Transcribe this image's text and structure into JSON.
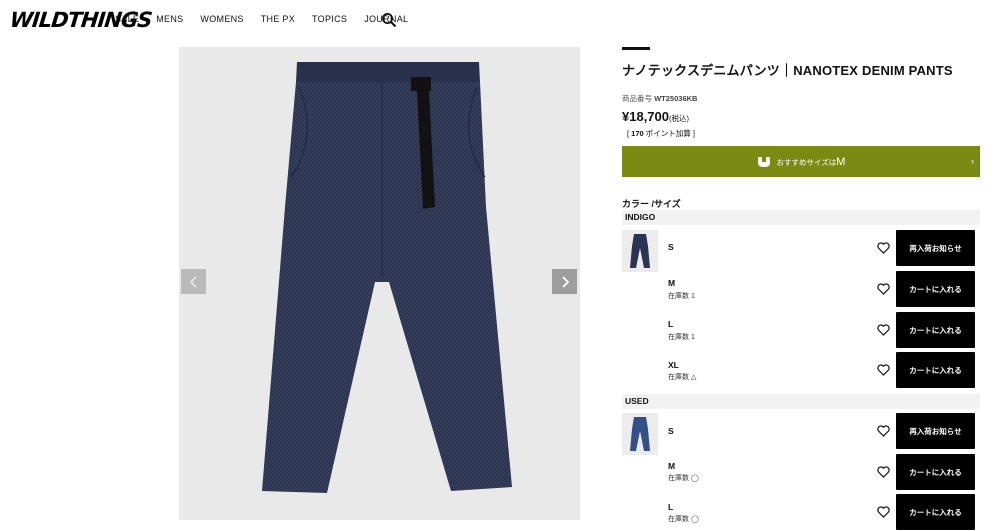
{
  "header": {
    "logo": "WILDTHINGS",
    "nav": [
      "SALE",
      "MENS",
      "WOMENS",
      "THE PX",
      "TOPICS",
      "JOURNAL"
    ],
    "search_icon": "search-icon"
  },
  "gallery": {
    "prev_icon": "chevron-left-icon",
    "next_icon": "chevron-right-icon"
  },
  "product": {
    "title": "ナノテックスデニムパンツ｜NANOTEX DENIM PANTS",
    "code_label": "商品番号",
    "code": "WT25036KB",
    "price": "¥18,700",
    "tax": "(税込)",
    "points_open": "[ ",
    "points_value": "170",
    "points_label": " ポイント加算 ]",
    "size_rec_prefix": "おすすめサイズは",
    "size_rec_value": "M",
    "color_size_label": "カラー /サイズ"
  },
  "variants": [
    {
      "color": "INDIGO",
      "rows": [
        {
          "size": "S",
          "stock": "",
          "action": "再入荷お知らせ"
        },
        {
          "size": "M",
          "stock": "在庫数 1",
          "action": "カートに入れる"
        },
        {
          "size": "L",
          "stock": "在庫数 1",
          "action": "カートに入れる"
        },
        {
          "size": "XL",
          "stock": "在庫数 △",
          "action": "カートに入れる"
        }
      ]
    },
    {
      "color": "USED",
      "rows": [
        {
          "size": "S",
          "stock": "",
          "action": "再入荷お知らせ"
        },
        {
          "size": "M",
          "stock": "在庫数 ◯",
          "action": "カートに入れる"
        },
        {
          "size": "L",
          "stock": "在庫数 ◯",
          "action": "カートに入れる"
        }
      ]
    }
  ],
  "colors": {
    "accent_green": "#7a8b14",
    "button_black": "#000000",
    "indigo": "#2b3452",
    "used_blue": "#34508a"
  }
}
